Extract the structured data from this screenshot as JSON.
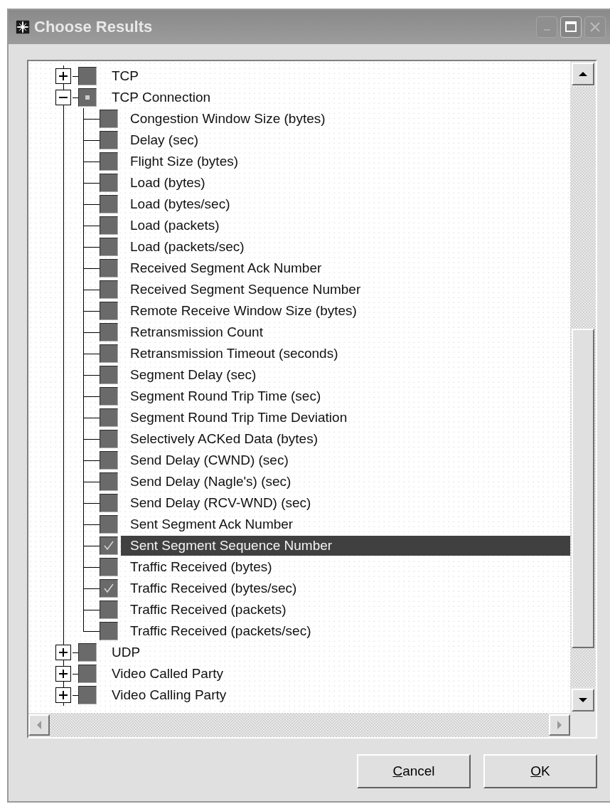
{
  "window": {
    "title": "Choose Results"
  },
  "tree": [
    {
      "label": "TCP",
      "expanded": false,
      "partial": false,
      "selected": false
    },
    {
      "label": "TCP Connection",
      "expanded": true,
      "partial": true,
      "selected": false,
      "children": [
        {
          "label": "Congestion Window Size (bytes)",
          "checked": false,
          "selected": false
        },
        {
          "label": "Delay (sec)",
          "checked": false,
          "selected": false
        },
        {
          "label": "Flight Size (bytes)",
          "checked": false,
          "selected": false
        },
        {
          "label": "Load (bytes)",
          "checked": false,
          "selected": false
        },
        {
          "label": "Load (bytes/sec)",
          "checked": false,
          "selected": false
        },
        {
          "label": "Load (packets)",
          "checked": false,
          "selected": false
        },
        {
          "label": "Load (packets/sec)",
          "checked": false,
          "selected": false
        },
        {
          "label": "Received Segment Ack Number",
          "checked": false,
          "selected": false
        },
        {
          "label": "Received Segment Sequence Number",
          "checked": false,
          "selected": false
        },
        {
          "label": "Remote Receive Window Size (bytes)",
          "checked": false,
          "selected": false
        },
        {
          "label": "Retransmission Count",
          "checked": false,
          "selected": false
        },
        {
          "label": "Retransmission Timeout (seconds)",
          "checked": false,
          "selected": false
        },
        {
          "label": "Segment Delay (sec)",
          "checked": false,
          "selected": false
        },
        {
          "label": "Segment Round Trip Time (sec)",
          "checked": false,
          "selected": false
        },
        {
          "label": "Segment Round Trip Time Deviation",
          "checked": false,
          "selected": false
        },
        {
          "label": "Selectively ACKed Data (bytes)",
          "checked": false,
          "selected": false
        },
        {
          "label": "Send Delay (CWND) (sec)",
          "checked": false,
          "selected": false
        },
        {
          "label": "Send Delay (Nagle's) (sec)",
          "checked": false,
          "selected": false
        },
        {
          "label": "Send Delay (RCV-WND) (sec)",
          "checked": false,
          "selected": false
        },
        {
          "label": "Sent Segment Ack Number",
          "checked": false,
          "selected": false
        },
        {
          "label": "Sent Segment Sequence Number",
          "checked": true,
          "selected": true
        },
        {
          "label": "Traffic Received (bytes)",
          "checked": false,
          "selected": false
        },
        {
          "label": "Traffic Received (bytes/sec)",
          "checked": true,
          "selected": false
        },
        {
          "label": "Traffic Received (packets)",
          "checked": false,
          "selected": false
        },
        {
          "label": "Traffic Received (packets/sec)",
          "checked": false,
          "selected": false
        }
      ]
    },
    {
      "label": "UDP",
      "expanded": false,
      "partial": false,
      "selected": false
    },
    {
      "label": "Video Called Party",
      "expanded": false,
      "partial": false,
      "selected": false
    },
    {
      "label": "Video Calling Party",
      "expanded": false,
      "partial": false,
      "selected": false
    }
  ],
  "buttons": [
    {
      "label": "Cancel"
    },
    {
      "label": "OK"
    }
  ]
}
